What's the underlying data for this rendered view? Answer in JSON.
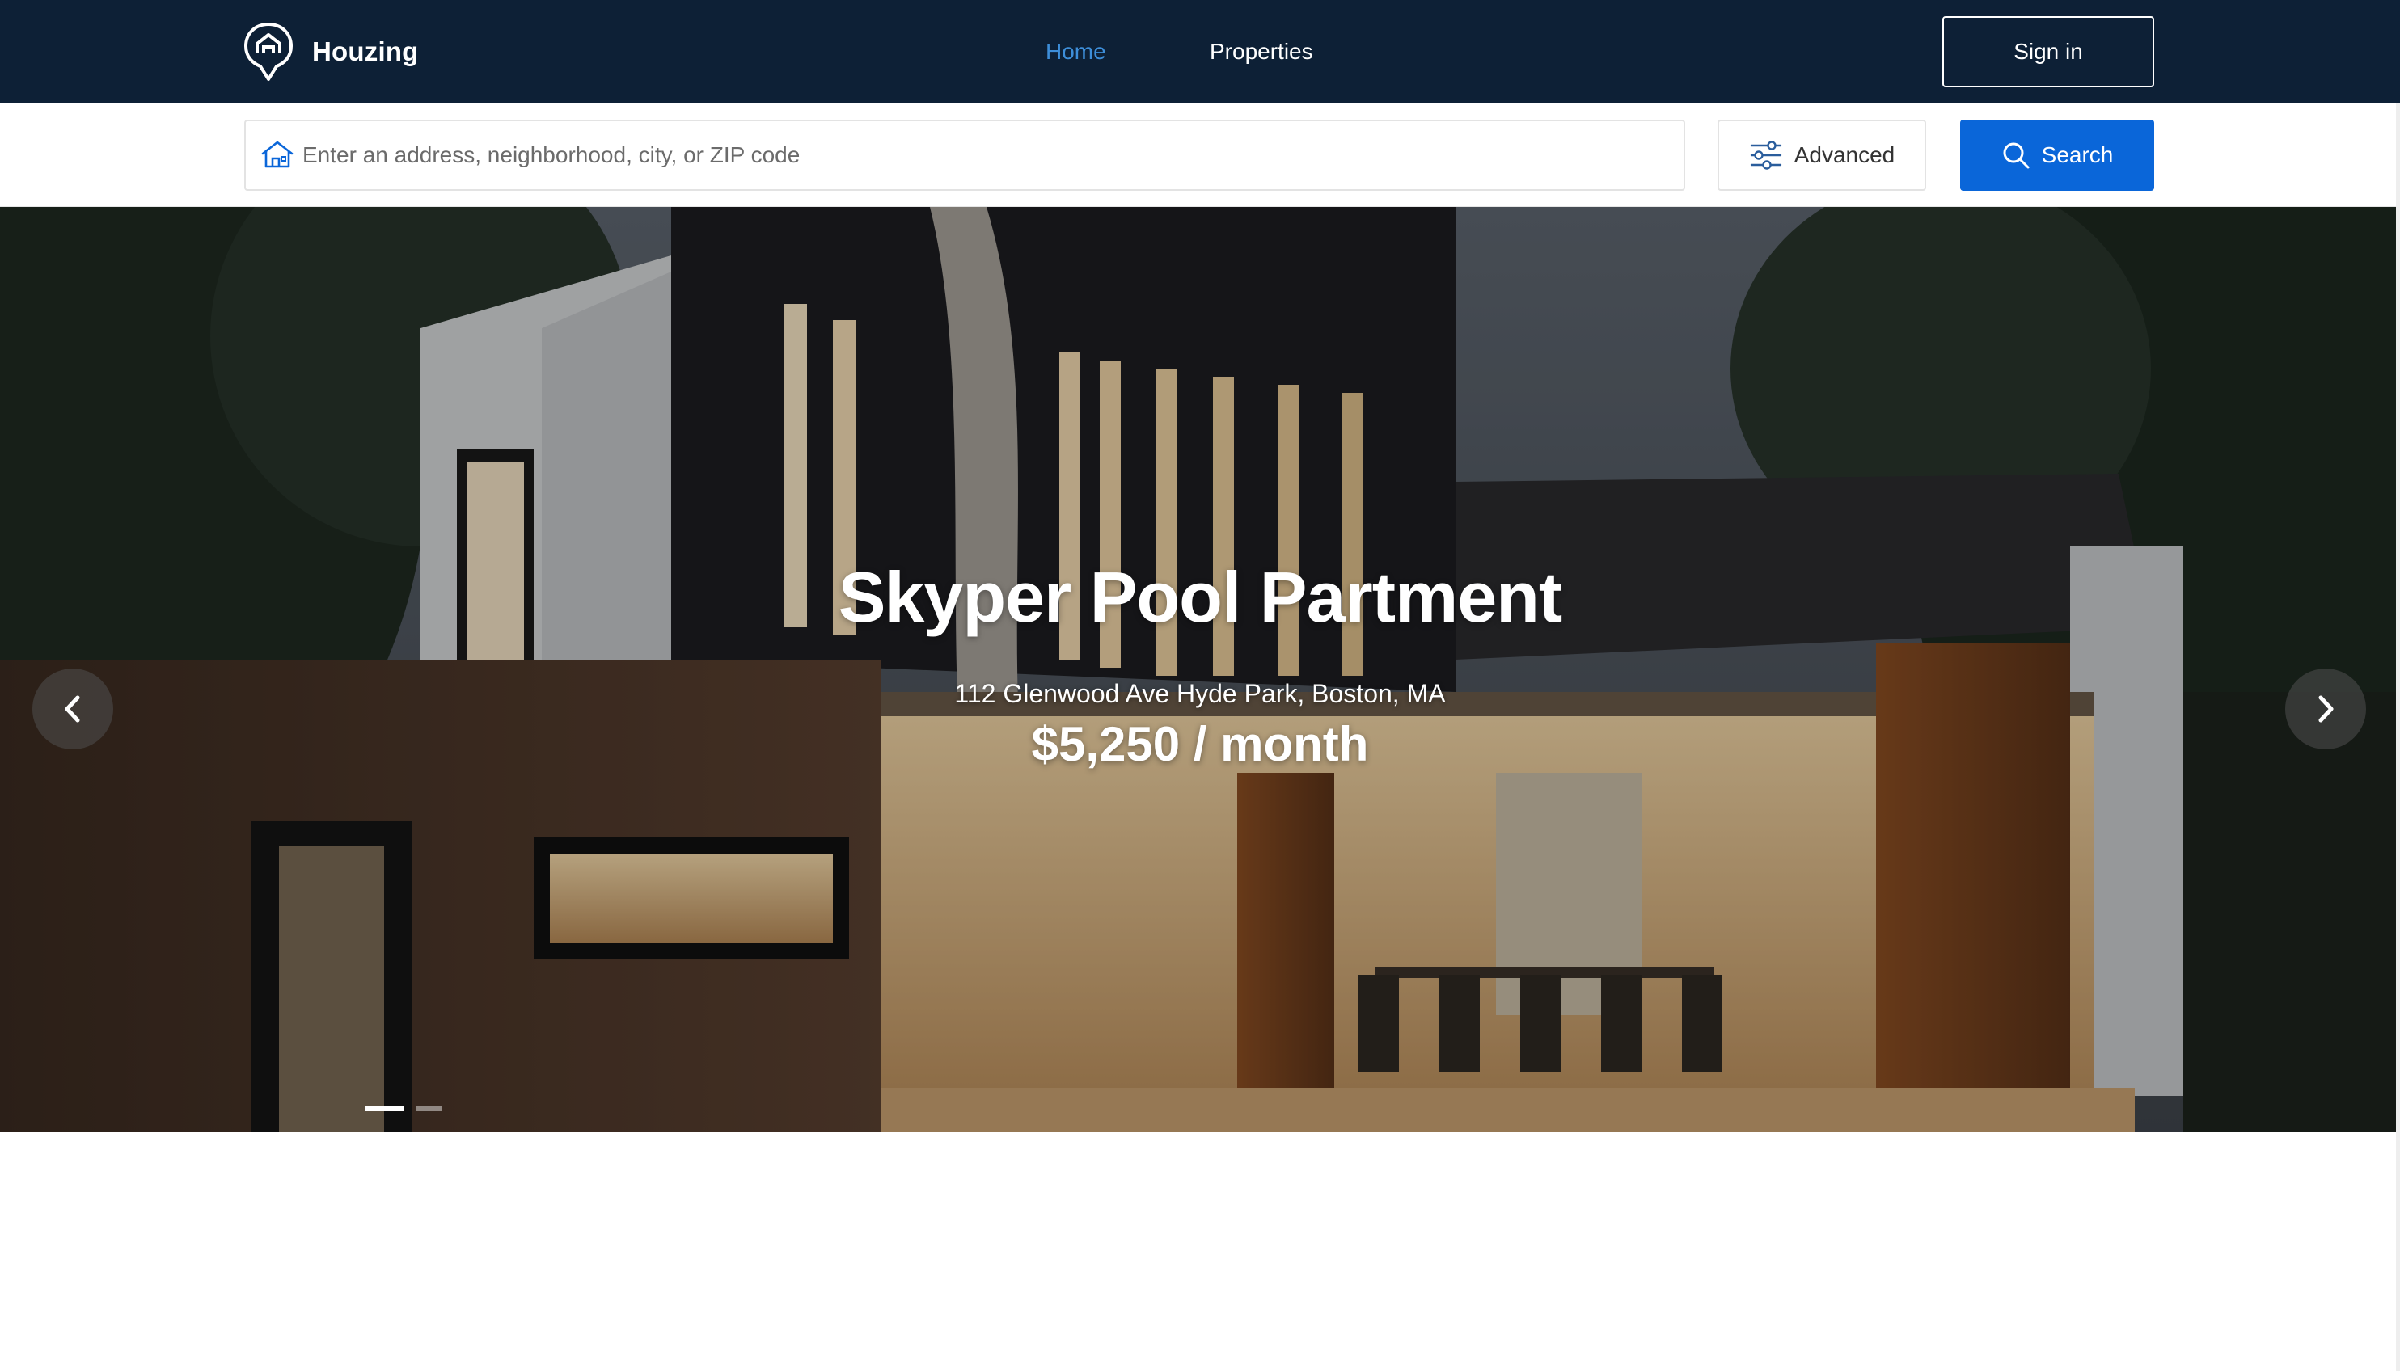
{
  "nav": {
    "brand": "Houzing",
    "links": {
      "home": "Home",
      "properties": "Properties"
    },
    "active_link": "home",
    "signin_label": "Sign in"
  },
  "search": {
    "placeholder": "Enter an address, neighborhood, city, or ZIP code",
    "value": "",
    "advanced_label": "Advanced",
    "search_label": "Search"
  },
  "hero": {
    "title": "Skyper Pool Partment",
    "address": "112 Glenwood Ave Hyde Park, Boston, MA",
    "price": "$5,250 / month",
    "slide_count": 2,
    "active_slide": 1
  },
  "icons": {
    "brand": "house-pin-logo-icon",
    "search_field": "house-icon",
    "advanced": "sliders-icon",
    "search": "magnifier-icon",
    "prev": "chevron-left-icon",
    "next": "chevron-right-icon"
  },
  "colors": {
    "navbar_bg": "#0d2036",
    "link_active": "#3d8ed9",
    "primary": "#0a66d9",
    "white": "#ffffff"
  }
}
